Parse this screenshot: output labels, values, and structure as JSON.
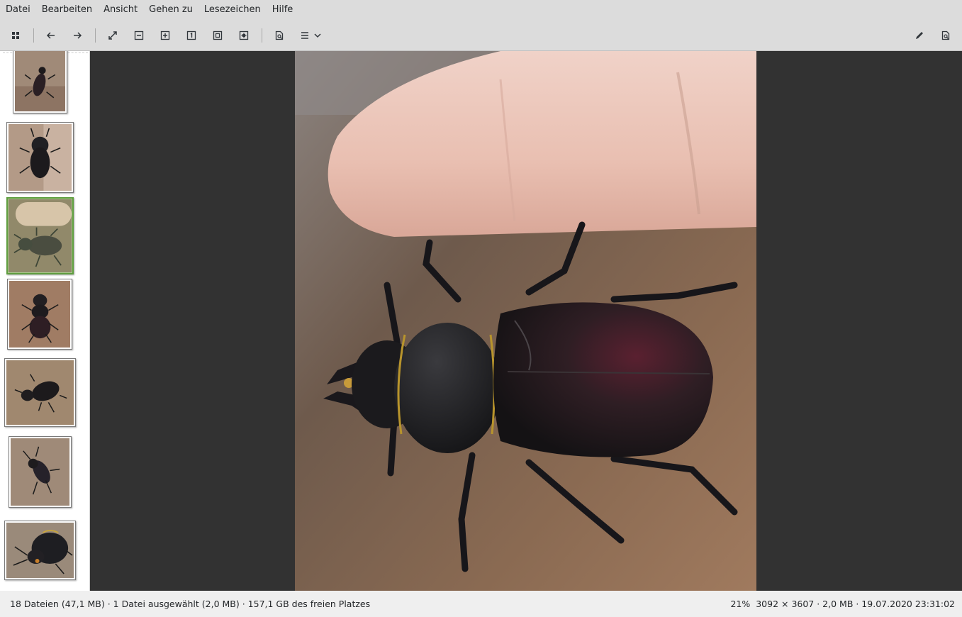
{
  "menu": {
    "file": "Datei",
    "edit": "Bearbeiten",
    "view": "Ansicht",
    "go": "Gehen zu",
    "bookmarks": "Lesezeichen",
    "help": "Hilfe"
  },
  "toolbar": {
    "icons": [
      "grid-icon",
      "arrow-left-icon",
      "arrow-right-icon",
      "fullscreen-icon",
      "zoom-out-icon",
      "zoom-in-icon",
      "zoom-original-icon",
      "zoom-fit-icon",
      "zoom-fill-icon",
      "print-preview-icon",
      "hamburger-menu-icon",
      "pencil-icon",
      "print-preview-icon"
    ]
  },
  "thumbnails": [
    {
      "name": "beetle-1",
      "selected": false
    },
    {
      "name": "beetle-2",
      "selected": false
    },
    {
      "name": "beetle-finger",
      "selected": true
    },
    {
      "name": "beetle-4",
      "selected": false
    },
    {
      "name": "beetle-5",
      "selected": false
    },
    {
      "name": "beetle-6",
      "selected": false
    },
    {
      "name": "beetle-7",
      "selected": false
    }
  ],
  "status": {
    "left": "18 Dateien (47,1 MB) · 1 Datei ausgewählt (2,0 MB) · 157,1 GB des freien Platzes",
    "right": "21%  3092 × 3607 · 2,0 MB · 19.07.2020 23:31:02"
  },
  "colors": {
    "accent_selection": "#5f9e3f",
    "viewer_background": "#323232"
  }
}
